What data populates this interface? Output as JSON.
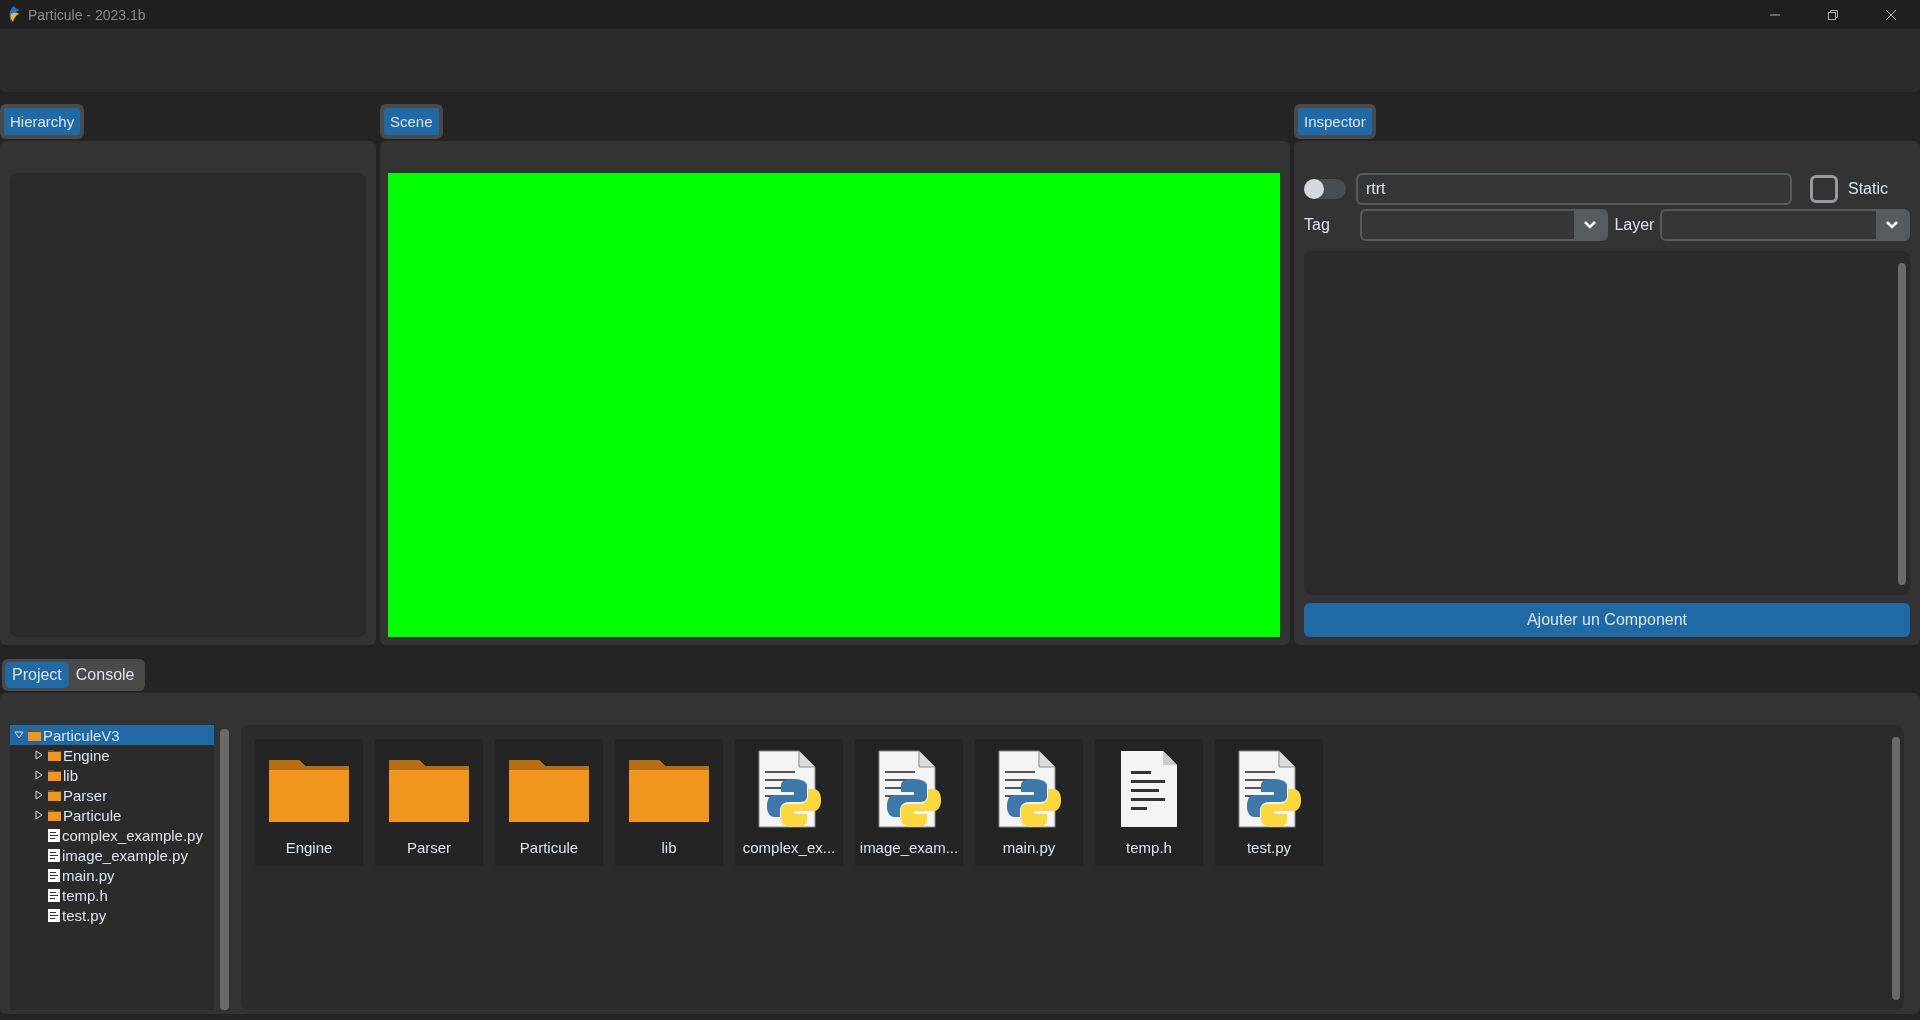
{
  "window": {
    "title": "Particule - 2023.1b"
  },
  "panels": {
    "hierarchy": {
      "title": "Hierarchy"
    },
    "scene": {
      "title": "Scene"
    },
    "inspector": {
      "title": "Inspector"
    }
  },
  "inspector": {
    "active": false,
    "name": "rtrt",
    "static": {
      "label": "Static",
      "checked": false
    },
    "tag": {
      "label": "Tag"
    },
    "layer": {
      "label": "Layer"
    },
    "add_button": "Ajouter un Component"
  },
  "bottom_tabs": [
    {
      "label": "Project",
      "selected": true
    },
    {
      "label": "Console",
      "selected": false
    }
  ],
  "tree": [
    {
      "label": "ParticuleV3",
      "kind": "folder",
      "expanded": true,
      "selected": true,
      "children": [
        {
          "label": "Engine",
          "kind": "folder",
          "expanded": false,
          "selected": false
        },
        {
          "label": "lib",
          "kind": "folder",
          "expanded": false,
          "selected": false
        },
        {
          "label": "Parser",
          "kind": "folder",
          "expanded": false,
          "selected": false
        },
        {
          "label": "Particule",
          "kind": "folder",
          "expanded": false,
          "selected": false
        },
        {
          "label": "complex_example.py",
          "kind": "file",
          "selected": false
        },
        {
          "label": "image_example.py",
          "kind": "file",
          "selected": false
        },
        {
          "label": "main.py",
          "kind": "file",
          "selected": false
        },
        {
          "label": "temp.h",
          "kind": "file",
          "selected": false
        },
        {
          "label": "test.py",
          "kind": "file",
          "selected": false
        }
      ]
    }
  ],
  "files": [
    {
      "label": "Engine",
      "kind": "folder"
    },
    {
      "label": "Parser",
      "kind": "folder"
    },
    {
      "label": "Particule",
      "kind": "folder"
    },
    {
      "label": "lib",
      "kind": "folder"
    },
    {
      "label": "complex_ex...",
      "kind": "python"
    },
    {
      "label": "image_exam...",
      "kind": "python"
    },
    {
      "label": "main.py",
      "kind": "python"
    },
    {
      "label": "temp.h",
      "kind": "text"
    },
    {
      "label": "test.py",
      "kind": "python"
    }
  ]
}
